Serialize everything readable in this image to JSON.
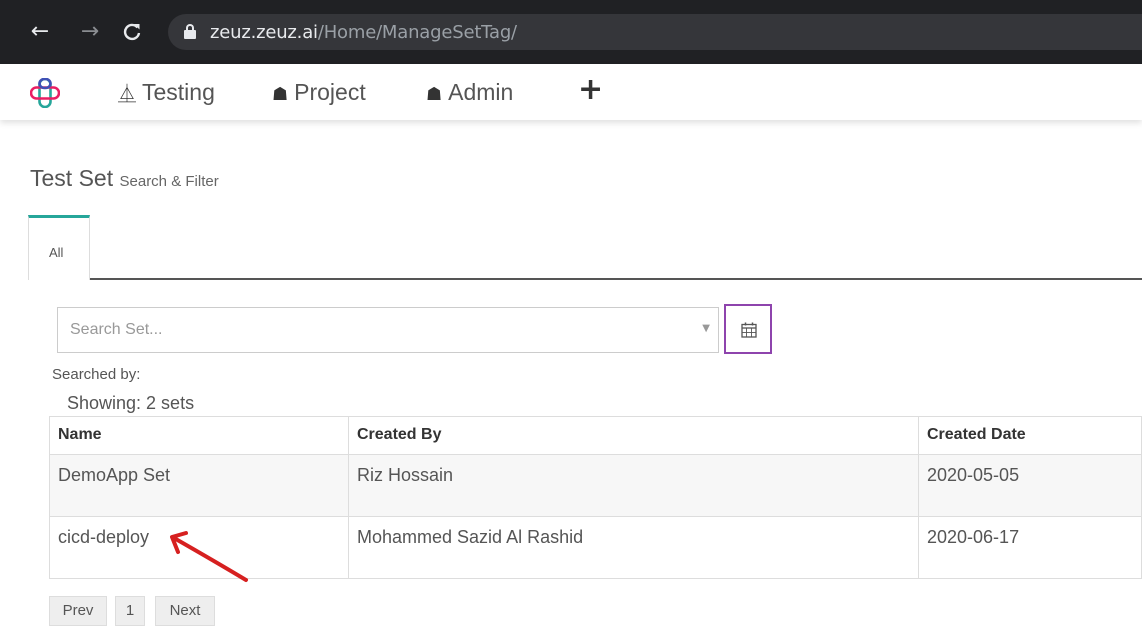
{
  "browser": {
    "back_icon": "arrow-left-icon",
    "forward_icon": "arrow-right-icon",
    "reload_icon": "reload-icon",
    "lock_icon": "lock-icon",
    "url_host": "zeuz.zeuz.ai",
    "url_path": "/Home/ManageSetTag/"
  },
  "nav": {
    "items": [
      {
        "label": "Testing",
        "icon": "flask-icon"
      },
      {
        "label": "Project",
        "icon": "sitemap-icon"
      },
      {
        "label": "Admin",
        "icon": "user-secret-icon"
      }
    ],
    "add_icon": "plus-icon"
  },
  "page": {
    "title": "Test Set",
    "subtitle": "Search & Filter"
  },
  "tabs": [
    {
      "label": "All",
      "active": true
    }
  ],
  "search": {
    "placeholder": "Search Set...",
    "value": ""
  },
  "searched_by_label": "Searched by:",
  "showing_label": "Showing: 2 sets",
  "table": {
    "headers": [
      "Name",
      "Created By",
      "Created Date"
    ],
    "rows": [
      [
        "DemoApp Set",
        "Riz Hossain",
        "2020-05-05"
      ],
      [
        "cicd-deploy",
        "Mohammed Sazid Al Rashid",
        "2020-06-17"
      ]
    ]
  },
  "pagination": {
    "prev": "Prev",
    "page": "1",
    "next": "Next"
  },
  "colors": {
    "tab_accent": "#26a69a",
    "calendar_border": "#8e44ad",
    "annotation": "#d62020"
  }
}
